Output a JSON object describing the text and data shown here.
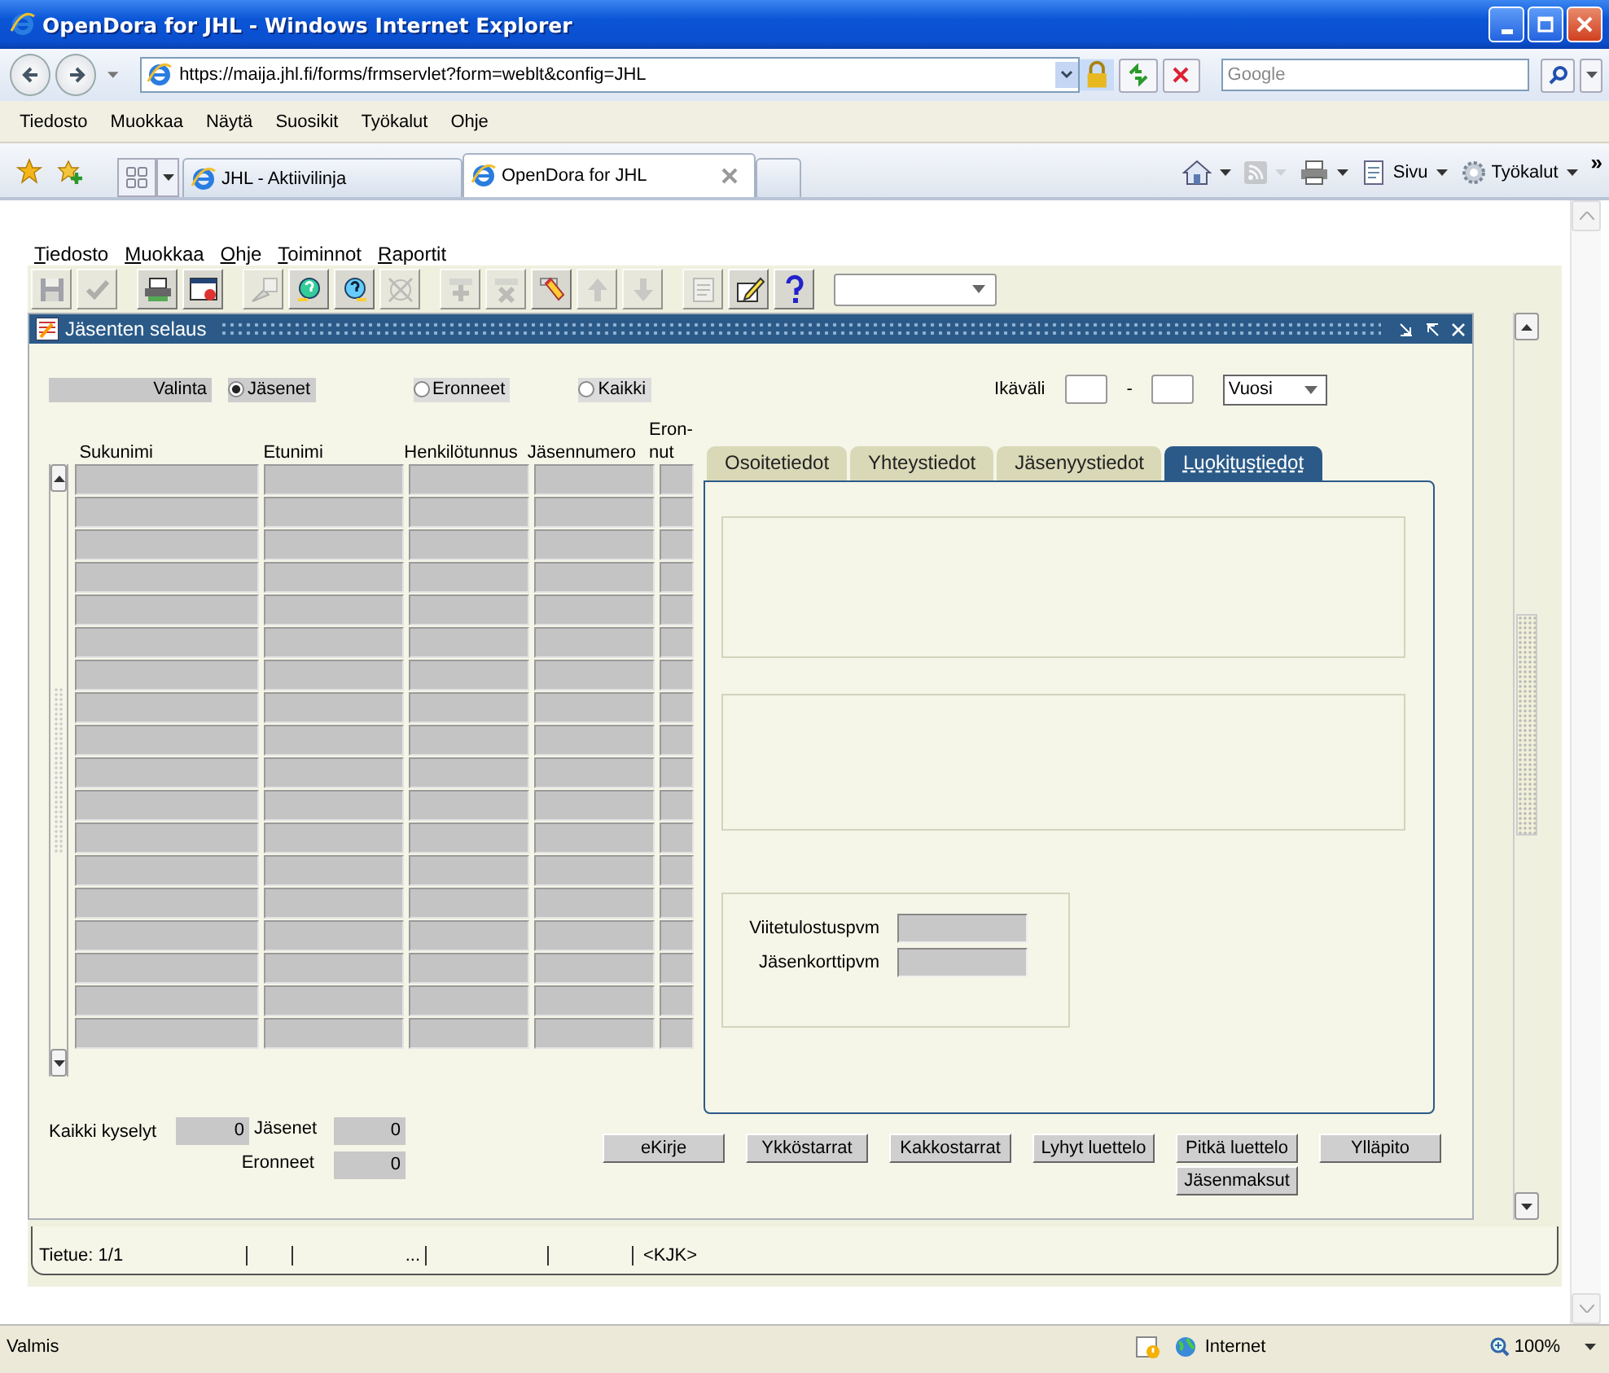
{
  "window": {
    "title": "OpenDora for JHL - Windows Internet Explorer"
  },
  "address_bar": {
    "url": "https://maija.jhl.fi/forms/frmservlet?form=weblt&config=JHL"
  },
  "search": {
    "placeholder": "Google"
  },
  "menu": [
    "Tiedosto",
    "Muokkaa",
    "Näytä",
    "Suosikit",
    "Työkalut",
    "Ohje"
  ],
  "tabs": [
    {
      "label": "JHL - Aktiivilinja",
      "selected": false
    },
    {
      "label": "OpenDora for JHL",
      "selected": true
    }
  ],
  "command_bar": [
    {
      "kind": "home"
    },
    {
      "kind": "feeds",
      "disabled": true
    },
    {
      "kind": "print"
    },
    {
      "kind": "page",
      "label": "Sivu"
    },
    {
      "kind": "tools",
      "label": "Työkalut"
    }
  ],
  "more": "»",
  "app": {
    "menu": [
      "Tiedosto",
      "Muokkaa",
      "Ohje",
      "Toiminnot",
      "Raportit"
    ],
    "toolbar": [
      [
        {
          "kind": "save",
          "disabled": true
        },
        {
          "kind": "accept",
          "disabled": true
        }
      ],
      [
        {
          "kind": "print",
          "disabled": false
        },
        {
          "kind": "report",
          "disabled": false
        }
      ],
      [
        {
          "kind": "search",
          "disabled": true
        },
        {
          "kind": "enter",
          "disabled": false
        },
        {
          "kind": "execute",
          "disabled": false
        },
        {
          "kind": "cancel",
          "disabled": true
        }
      ],
      [
        {
          "kind": "insert",
          "disabled": true
        },
        {
          "kind": "delete",
          "disabled": true
        },
        {
          "kind": "clear",
          "disabled": false
        },
        {
          "kind": "up",
          "disabled": true
        },
        {
          "kind": "down",
          "disabled": true
        }
      ],
      [
        {
          "kind": "list",
          "disabled": true
        },
        {
          "kind": "edit",
          "disabled": false
        },
        {
          "kind": "help",
          "disabled": false
        }
      ]
    ],
    "form": {
      "title": "Jäsenten selaus",
      "filter": {
        "label": "Valinta",
        "options": [
          {
            "label": "Jäsenet",
            "selected": true
          },
          {
            "label": "Eronneet",
            "selected": false
          },
          {
            "label": "Kaikki",
            "selected": false
          }
        ]
      },
      "age": {
        "label": "Ikäväli",
        "separator": "-",
        "unit": "Vuosi"
      },
      "grid": {
        "columns": [
          "Sukunimi",
          "Etunimi",
          "Henkilötunnus",
          "Jäsennumero",
          "Eron-nut"
        ],
        "rows": [
          {
            "selected": false
          },
          {
            "selected": false
          },
          {
            "selected": false
          },
          {
            "selected": false
          },
          {
            "selected": false
          },
          {
            "selected": false
          },
          {
            "selected": false
          },
          {
            "selected": false
          },
          {
            "selected": false
          },
          {
            "selected": false
          },
          {
            "selected": false
          },
          {
            "selected": false
          },
          {
            "selected": false
          },
          {
            "selected": false
          },
          {
            "selected": false
          },
          {
            "selected": false
          },
          {
            "selected": false
          },
          {
            "selected": false
          }
        ]
      },
      "tabs": [
        {
          "label": "Osoitetiedot",
          "selected": false
        },
        {
          "label": "Yhteystiedot",
          "selected": false
        },
        {
          "label": "Jäsenyystiedot",
          "selected": false
        },
        {
          "label": "Luokitustiedot",
          "selected": true
        }
      ],
      "fields": [
        {
          "label": "Viitetulostuspvm"
        },
        {
          "label": "Jäsenkorttipvm"
        }
      ],
      "totals": [
        {
          "label": "Kaikki kyselyt",
          "value": "0"
        },
        {
          "label": "Jäsenet",
          "value": "0"
        },
        {
          "label": "Eronneet",
          "value": "0"
        }
      ],
      "buttons": [
        "eKirje",
        "Ykköstarrat",
        "Kakkostarrat",
        "Lyhyt luettelo",
        "Pitkä luettelo",
        "Ylläpito"
      ],
      "extra_button": "Jäsenmaksut"
    },
    "status": [
      {
        "text": "Tietue: 1/1"
      },
      {
        "text": "..."
      },
      {
        "text": "<KJK>"
      }
    ]
  },
  "status_bar": {
    "text": "Valmis",
    "zone": "Internet",
    "zoom": "100%"
  }
}
